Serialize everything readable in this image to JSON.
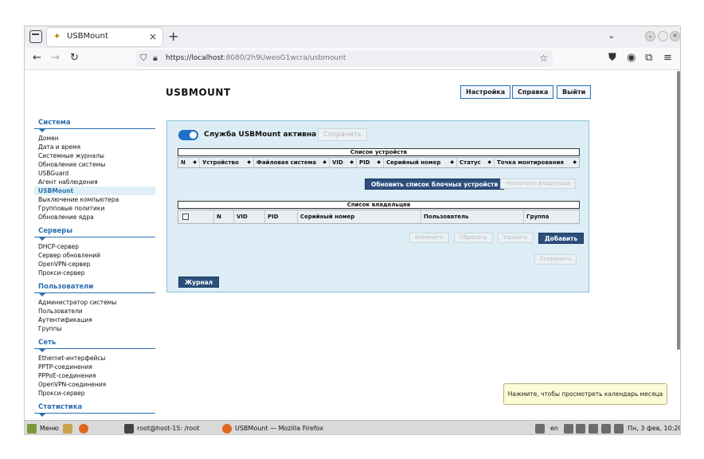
{
  "browser": {
    "tab_title": "USBMount",
    "tab_close": "×",
    "new_tab": "+",
    "list_all_tabs": "⌄",
    "url_host": "https://localhost",
    "url_rest": ":8080/2h9UweoG1wcra/usbmount",
    "icons": [
      "tab-list-icon",
      "back-icon",
      "forward-icon",
      "reload-icon",
      "shield-icon",
      "lock-icon",
      "star-icon",
      "pocket-icon",
      "account-icon",
      "extensions-icon",
      "menu-icon"
    ]
  },
  "header": {
    "title": "USBMOUNT",
    "buttons": [
      "Настройка",
      "Справка",
      "Выйти"
    ]
  },
  "sidebar": {
    "groups": [
      {
        "title": "Система",
        "items": [
          "Домен",
          "Дата и время",
          "Системные журналы",
          "Обновление системы",
          "USBGuard",
          "Агент наблюдения",
          "USBMount",
          "Выключение компьютера",
          "Групповые политики",
          "Обновление ядра"
        ]
      },
      {
        "title": "Серверы",
        "items": [
          "DHCP-сервер",
          "Сервер обновлений",
          "OpenVPN-сервер",
          "Прокси-сервер"
        ]
      },
      {
        "title": "Пользователи",
        "items": [
          "Администратор системы",
          "Пользователи",
          "Аутентификация",
          "Группы"
        ]
      },
      {
        "title": "Сеть",
        "items": [
          "Ethernet-интерфейсы",
          "PPTP-соединения",
          "PPPoE-соединения",
          "OpenVPN-соединения",
          "Прокси-сервер"
        ]
      },
      {
        "title": "Статистика",
        "items": []
      }
    ],
    "active_item": "USBMount"
  },
  "panel": {
    "service_label": "Служба USBMount активна",
    "service_active": true,
    "save_top": "Сохранить",
    "devices_caption": "Список устройств",
    "devices_columns": [
      "N",
      "Устройство",
      "Файловая система",
      "VID",
      "PID",
      "Серийный номер",
      "Статус",
      "Точка монтирования"
    ],
    "refresh_button": "Обновить список блочных устройств",
    "assign_owner_button": "Назначить владельца",
    "owners_caption": "Список владельцев",
    "owners_columns": [
      "N",
      "VID",
      "PID",
      "Серийный номер",
      "Пользователь",
      "Группа"
    ],
    "edit_button": "Изменить",
    "reset_button": "Сбросить",
    "delete_button": "Удалить",
    "add_button": "Добавить",
    "save_bottom": "Сохранить",
    "journal_button": "Журнал",
    "sort_glyph": "◆"
  },
  "tooltip": "Нажмите, чтобы просмотреть календарь месяца",
  "taskbar": {
    "menu": "Меню",
    "terminal": "root@host-15: /root",
    "firefox": "USBMount — Mozilla Firefox",
    "lang": "en",
    "clock": "Пн, 3 фев, 10:20"
  },
  "colors": {
    "accent": "#2b6fb0",
    "primary_button": "#2c4f7c",
    "panel_bg": "#dcedf5",
    "toggle": "#1e6fc9"
  }
}
